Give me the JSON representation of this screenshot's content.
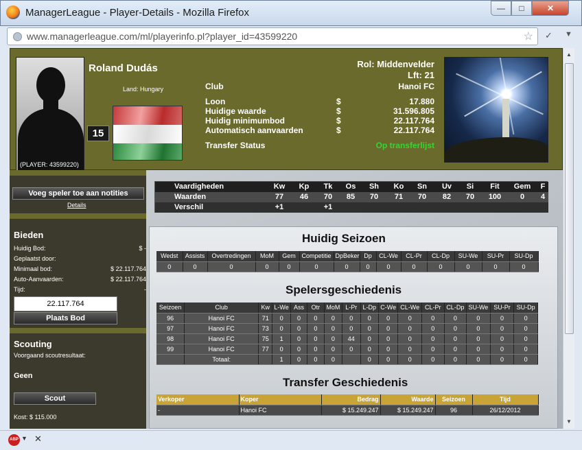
{
  "window": {
    "title": "ManagerLeague - Player-Details - Mozilla Firefox",
    "url": "www.managerleague.com/ml/playerinfo.pl?player_id=43599220"
  },
  "player": {
    "name": "Roland Dudás",
    "id_label": "(PLAYER: 43599220)",
    "land": "Land: Hungary",
    "number": "15",
    "rol": "Rol: Middenvelder",
    "lft": "Lft: 21"
  },
  "finance": {
    "club_label": "Club",
    "club_value": "Hanoi FC",
    "rows": [
      {
        "label": "Loon",
        "currency": "$",
        "value": "17.880"
      },
      {
        "label": "Huidige waarde",
        "currency": "$",
        "value": "31.596.805"
      },
      {
        "label": "Huidig minimumbod",
        "currency": "$",
        "value": "22.117.764"
      },
      {
        "label": "Automatisch aanvaarden",
        "currency": "$",
        "value": "22.117.764"
      }
    ],
    "transfer_label": "Transfer Status",
    "transfer_value": "Op transferlijst",
    "transfer_color": "#34d534"
  },
  "sidebar": {
    "notes_button": "Voeg speler toe aan notities",
    "details_link": "Details",
    "bieden_title": "Bieden",
    "bid_rows": [
      {
        "label": "Huidig Bod:",
        "value": "$ -"
      },
      {
        "label": "Geplaatst door:",
        "value": ""
      },
      {
        "label": "Minimaal bod:",
        "value": "$ 22.117.764"
      },
      {
        "label": "Auto-Aanvaarden:",
        "value": "$ 22.117.764"
      },
      {
        "label": "Tijd:",
        "value": "-"
      }
    ],
    "bid_input_value": "22.117.764",
    "bid_button": "Plaats Bod",
    "scouting_title": "Scouting",
    "scout_prev_label": "Voorgaand scoutresultaat:",
    "scout_result": "Geen",
    "scout_button": "Scout",
    "scout_cost": "Kost: $ 115.000"
  },
  "skills": {
    "headers": [
      "Vaardigheden",
      "Kw",
      "Kp",
      "Tk",
      "Os",
      "Sh",
      "Ko",
      "Sn",
      "Uv",
      "Si",
      "Fit",
      "Gem",
      "F"
    ],
    "values_label": "Waarden",
    "values": [
      "77",
      "46",
      "70",
      "85",
      "70",
      "71",
      "70",
      "82",
      "70",
      "100",
      "0",
      "4"
    ],
    "diff_label": "Verschil",
    "diff": [
      "+1",
      "",
      "+1",
      "",
      "",
      "",
      "",
      "",
      "",
      "",
      "",
      ""
    ]
  },
  "season": {
    "title": "Huidig Seizoen",
    "headers": [
      "Wedst",
      "Assists",
      "Overtredingen",
      "MoM",
      "Gem",
      "Competitie",
      "DpBeker",
      "Dp",
      "CL-We",
      "CL-Pr",
      "CL-Dp",
      "SU-We",
      "SU-Pr",
      "SU-Dp"
    ],
    "values": [
      "0",
      "0",
      "0",
      "0",
      "0",
      "0",
      "0",
      "0",
      "0",
      "0",
      "0",
      "0",
      "0",
      "0"
    ]
  },
  "history": {
    "title": "Spelersgeschiedenis",
    "headers": [
      "Seizoen",
      "Club",
      "Kw",
      "L-We",
      "Ass",
      "Otr",
      "MoM",
      "L-Pr",
      "L-Dp",
      "C-We",
      "CL-We",
      "CL-Pr",
      "CL-Dp",
      "SU-We",
      "SU-Pr",
      "SU-Dp"
    ],
    "rows": [
      [
        "96",
        "Hanoi FC",
        "71",
        "0",
        "0",
        "0",
        "0",
        "0",
        "0",
        "0",
        "0",
        "0",
        "0",
        "0",
        "0",
        "0"
      ],
      [
        "97",
        "Hanoi FC",
        "73",
        "0",
        "0",
        "0",
        "0",
        "0",
        "0",
        "0",
        "0",
        "0",
        "0",
        "0",
        "0",
        "0"
      ],
      [
        "98",
        "Hanoi FC",
        "75",
        "1",
        "0",
        "0",
        "0",
        "44",
        "0",
        "0",
        "0",
        "0",
        "0",
        "0",
        "0",
        "0"
      ],
      [
        "99",
        "Hanoi FC",
        "77",
        "0",
        "0",
        "0",
        "0",
        "0",
        "0",
        "0",
        "0",
        "0",
        "0",
        "0",
        "0",
        "0"
      ],
      [
        "",
        "Totaal:",
        "",
        "1",
        "0",
        "0",
        "0",
        "",
        "0",
        "0",
        "0",
        "0",
        "0",
        "0",
        "0",
        "0"
      ]
    ]
  },
  "transfers": {
    "title": "Transfer Geschiedenis",
    "headers": [
      "Verkoper",
      "Koper",
      "Bedrag",
      "Waarde",
      "Seizoen",
      "Tijd"
    ],
    "rows": [
      [
        "-",
        "Hanoi FC",
        "$ 15.249.247",
        "$ 15.249.247",
        "96",
        "26/12/2012"
      ]
    ]
  }
}
